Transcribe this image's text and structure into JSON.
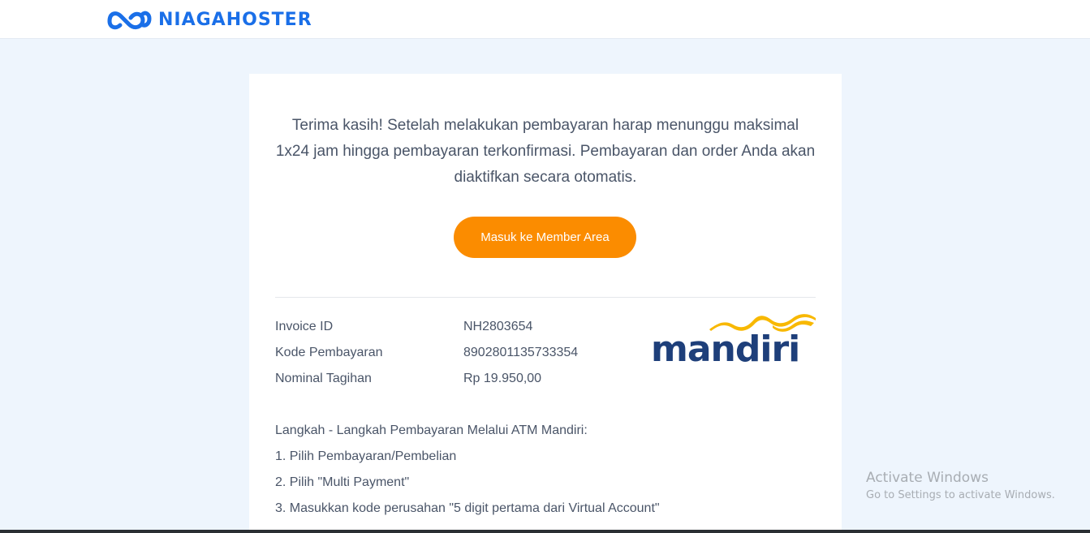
{
  "header": {
    "brand_name": "NIAGAHOSTER",
    "brand_color": "#1a6fe8"
  },
  "main": {
    "message": "Terima kasih! Setelah melakukan pembayaran harap menunggu maksimal 1x24 jam hingga pembayaran terkonfirmasi. Pembayaran dan order Anda akan diaktifkan secara otomatis.",
    "cta_label": "Masuk ke Member Area",
    "cta_color": "#fb8c00"
  },
  "invoice": {
    "rows": [
      {
        "label": "Invoice ID",
        "value": "NH2803654"
      },
      {
        "label": "Kode Pembayaran",
        "value": "8902801135733354"
      },
      {
        "label": "Nominal Tagihan",
        "value": "Rp 19.950,00"
      }
    ],
    "bank_logo_text": "mandiri",
    "bank_colors": {
      "text": "#1e3f7a",
      "wave": "#f8b800"
    }
  },
  "steps": {
    "title": "Langkah - Langkah Pembayaran Melalui ATM Mandiri:",
    "items": [
      "1. Pilih Pembayaran/Pembelian",
      "2. Pilih \"Multi Payment\"",
      "3. Masukkan kode perusahan \"5 digit pertama dari Virtual Account\""
    ]
  },
  "watermark": {
    "title": "Activate Windows",
    "subtitle": "Go to Settings to activate Windows."
  }
}
